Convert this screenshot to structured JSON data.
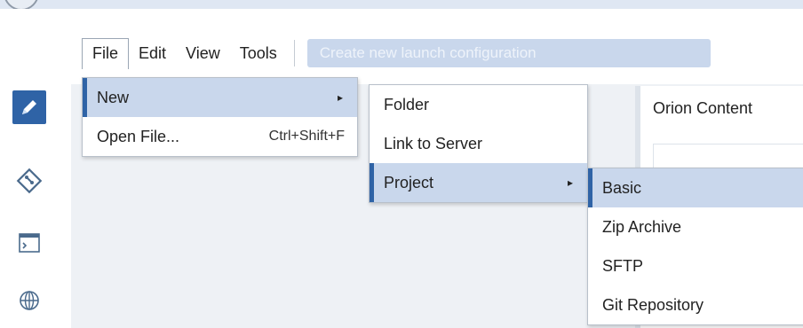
{
  "menubar": {
    "items": [
      {
        "label": "File"
      },
      {
        "label": "Edit"
      },
      {
        "label": "View"
      },
      {
        "label": "Tools"
      }
    ],
    "search_placeholder": "Create new launch configuration"
  },
  "file_menu": {
    "items": [
      {
        "label": "New",
        "arrow": "▸"
      },
      {
        "label": "Open File...",
        "shortcut": "Ctrl+Shift+F"
      }
    ]
  },
  "new_menu": {
    "items": [
      {
        "label": "Folder"
      },
      {
        "label": "Link to Server"
      },
      {
        "label": "Project",
        "arrow": "▸"
      }
    ]
  },
  "project_menu": {
    "items": [
      {
        "label": "Basic"
      },
      {
        "label": "Zip Archive"
      },
      {
        "label": "SFTP"
      },
      {
        "label": "Git Repository"
      }
    ]
  },
  "content_panel": {
    "title": "Orion Content"
  },
  "sidebar": {
    "icons": [
      "pencil-icon",
      "git-icon",
      "terminal-icon",
      "globe-icon"
    ]
  },
  "colors": {
    "accent": "#2f63a6",
    "highlight": "#c9d7ec",
    "workspace": "#eef1f5"
  }
}
